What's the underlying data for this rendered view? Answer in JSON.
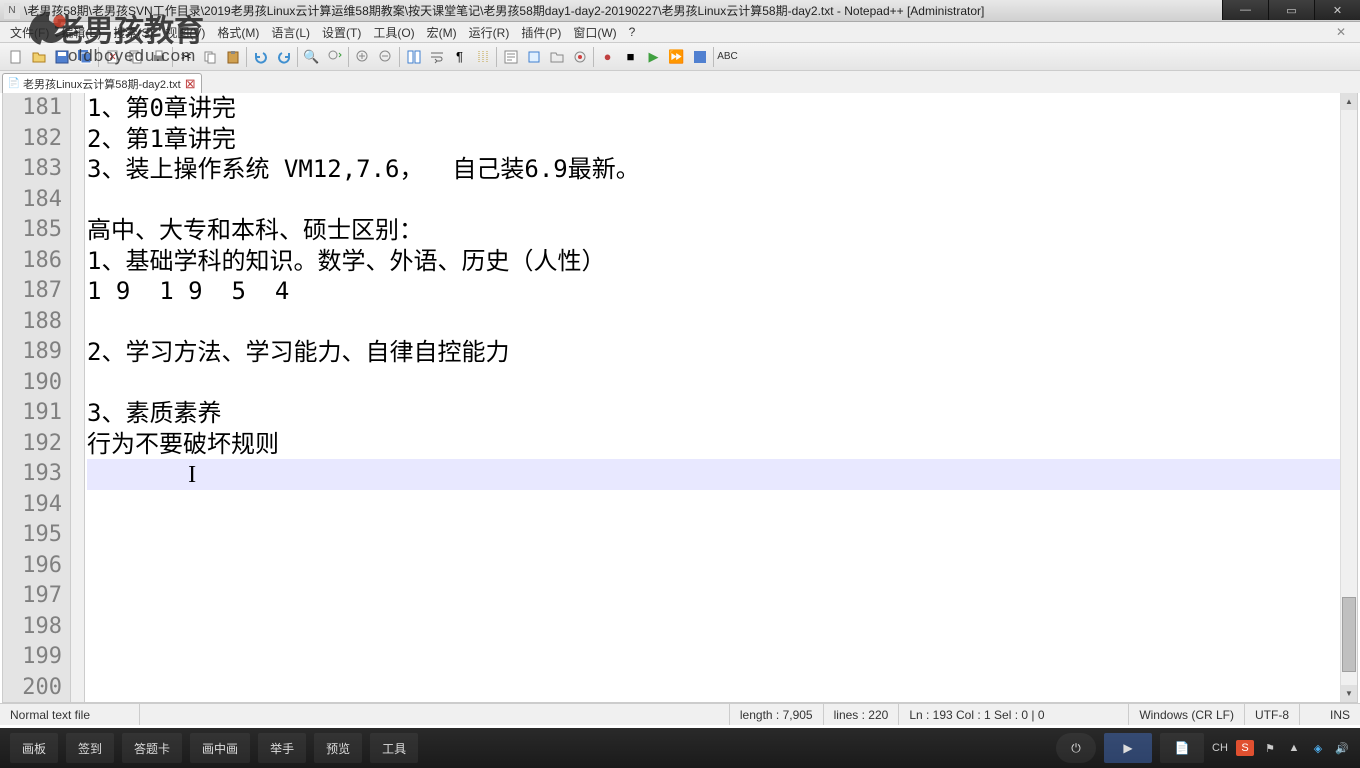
{
  "watermark": {
    "brand": "老男孩教育",
    "url": "oldboyedu.com"
  },
  "titlebar": {
    "path": "\\老男孩58期\\老男孩SVN工作目录\\2019老男孩Linux云计算运维58期教案\\按天课堂笔记\\老男孩58期day1-day2-20190227\\老男孩Linux云计算58期-day2.txt - Notepad++ [Administrator]"
  },
  "menu": {
    "items": [
      "文件(F)",
      "编辑(E)",
      "搜索(S)",
      "视图(V)",
      "格式(M)",
      "语言(L)",
      "设置(T)",
      "工具(O)",
      "宏(M)",
      "运行(R)",
      "插件(P)",
      "窗口(W)",
      "?"
    ]
  },
  "tab": {
    "label": "老男孩Linux云计算58期-day2.txt"
  },
  "lines": [
    {
      "num": 181,
      "text": "1、第0章讲完"
    },
    {
      "num": 182,
      "text": "2、第1章讲完"
    },
    {
      "num": 183,
      "text": "3、装上操作系统 VM12,7.6，  自己装6.9最新。"
    },
    {
      "num": 184,
      "text": ""
    },
    {
      "num": 185,
      "text": "高中、大专和本科、硕士区别："
    },
    {
      "num": 186,
      "text": "1、基础学科的知识。数学、外语、历史（人性）"
    },
    {
      "num": 187,
      "text": "1 9  1 9  5  4"
    },
    {
      "num": 188,
      "text": ""
    },
    {
      "num": 189,
      "text": "2、学习方法、学习能力、自律自控能力"
    },
    {
      "num": 190,
      "text": ""
    },
    {
      "num": 191,
      "text": "3、素质素养"
    },
    {
      "num": 192,
      "text": "行为不要破坏规则"
    },
    {
      "num": 193,
      "text": "",
      "current": true
    },
    {
      "num": 194,
      "text": ""
    },
    {
      "num": 195,
      "text": ""
    },
    {
      "num": 196,
      "text": ""
    },
    {
      "num": 197,
      "text": ""
    },
    {
      "num": 198,
      "text": ""
    },
    {
      "num": 199,
      "text": ""
    },
    {
      "num": 200,
      "text": ""
    }
  ],
  "status": {
    "filetype": "Normal text file",
    "length": "length : 7,905",
    "lines": "lines : 220",
    "pos": "Ln : 193    Col : 1    Sel : 0 | 0",
    "eol": "Windows (CR LF)",
    "encoding": "UTF-8",
    "mode": "INS"
  },
  "taskbar": {
    "items": [
      "画板",
      "签到",
      "答题卡",
      "画中画",
      "举手",
      "预览",
      "工具"
    ]
  },
  "tray": {
    "ime": "CH",
    "s": "S"
  }
}
